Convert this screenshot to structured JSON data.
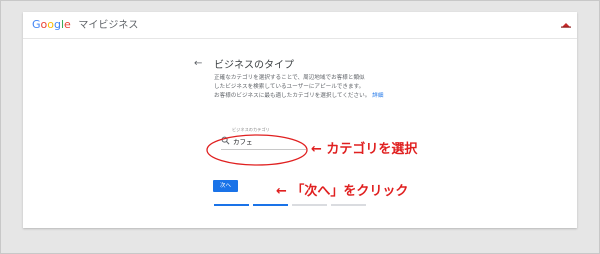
{
  "header": {
    "brand_g": "G",
    "brand_o1": "o",
    "brand_o2": "o",
    "brand_g2": "g",
    "brand_l": "l",
    "brand_e": "e",
    "product": "マイビジネス"
  },
  "page": {
    "back_arrow": "←",
    "title": "ビジネスのタイプ",
    "description_lines": [
      "正確なカテゴリを選択することで、周辺地域でお客様と類似",
      "したビジネスを検索しているユーザーにアピールできます。",
      "お客様のビジネスに最も適したカテゴリを選択してください。"
    ],
    "detail_link": "詳細"
  },
  "category": {
    "label": "ビジネスのカテゴリ",
    "value": "カフェ"
  },
  "next_button_label": "次へ",
  "progress": {
    "total_steps": 4,
    "completed_steps": 2
  },
  "annotations": {
    "select_category": "← カテゴリを選択",
    "click_next": "← 「次へ」をクリック",
    "color": "#e02020"
  },
  "colors": {
    "accent": "#1a73e8",
    "annotation": "#e02020"
  },
  "icons": {
    "back": "arrow-left-icon",
    "search": "search-icon",
    "corner": "hat-icon"
  }
}
